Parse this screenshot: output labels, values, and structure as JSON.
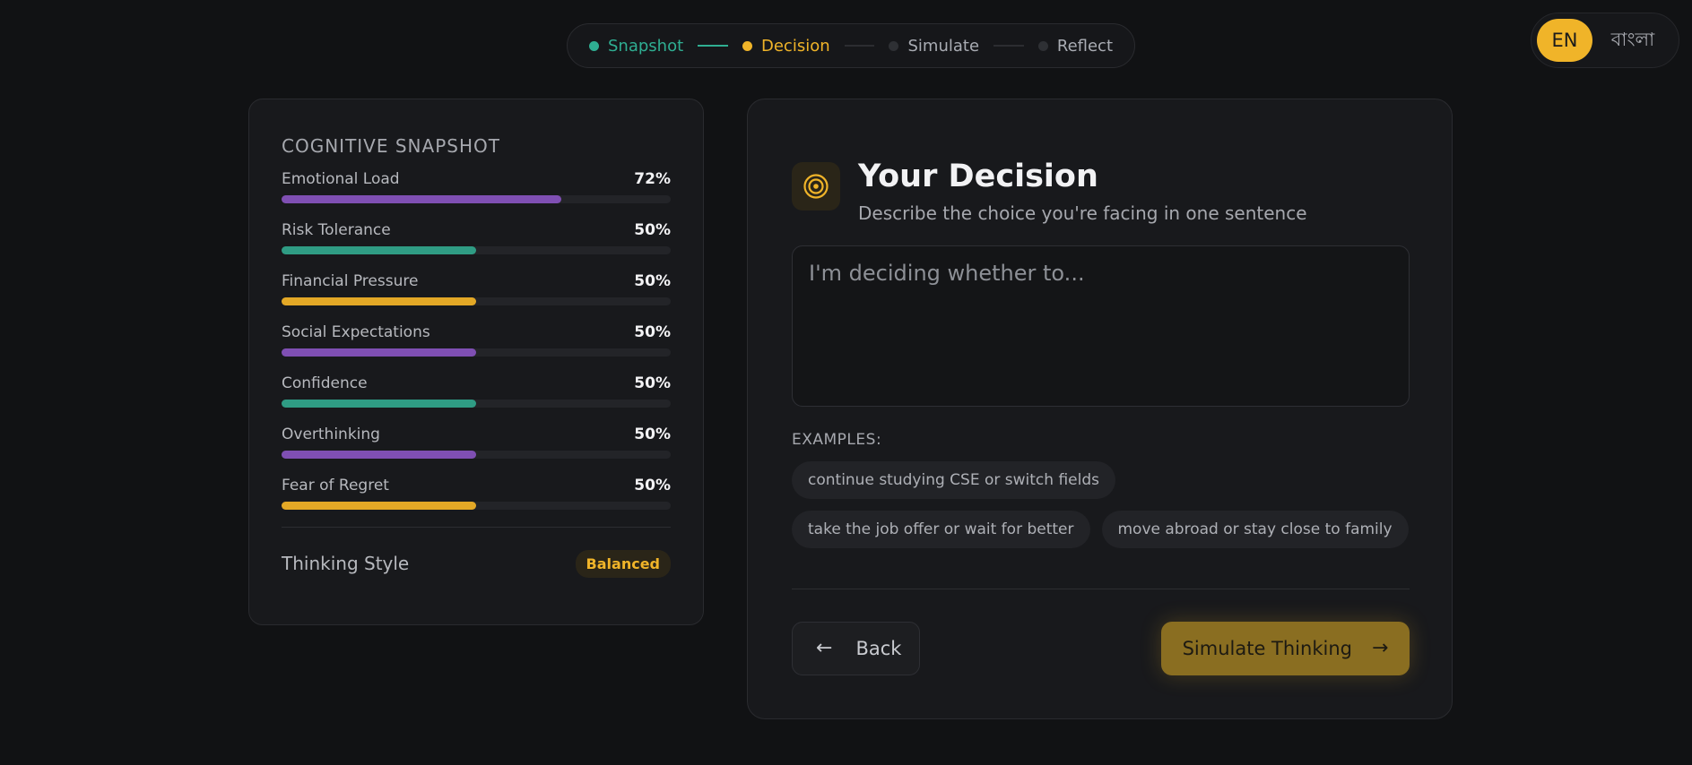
{
  "stepper": {
    "steps": [
      {
        "label": "Snapshot",
        "state": "done"
      },
      {
        "label": "Decision",
        "state": "active"
      },
      {
        "label": "Simulate",
        "state": "idle"
      },
      {
        "label": "Reflect",
        "state": "idle"
      }
    ]
  },
  "language": {
    "en": "EN",
    "bn": "বাংলা",
    "selected": "EN"
  },
  "snapshot": {
    "title": "COGNITIVE SNAPSHOT",
    "metrics": [
      {
        "label": "Emotional Load",
        "value": "72%",
        "percent": 72,
        "color": "#7f4fb3"
      },
      {
        "label": "Risk Tolerance",
        "value": "50%",
        "percent": 50,
        "color": "#2f9c84"
      },
      {
        "label": "Financial Pressure",
        "value": "50%",
        "percent": 50,
        "color": "#e3a826"
      },
      {
        "label": "Social Expectations",
        "value": "50%",
        "percent": 50,
        "color": "#7f4fb3"
      },
      {
        "label": "Confidence",
        "value": "50%",
        "percent": 50,
        "color": "#2f9c84"
      },
      {
        "label": "Overthinking",
        "value": "50%",
        "percent": 50,
        "color": "#7f4fb3"
      },
      {
        "label": "Fear of Regret",
        "value": "50%",
        "percent": 50,
        "color": "#e3a826"
      }
    ],
    "thinking_style_label": "Thinking Style",
    "thinking_style_value": "Balanced"
  },
  "decision": {
    "title": "Your Decision",
    "subtitle": "Describe the choice you're facing in one sentence",
    "input_value": "",
    "input_placeholder": "I'm deciding whether to...",
    "examples_label": "EXAMPLES:",
    "examples": [
      "continue studying CSE or switch fields",
      "take the job offer or wait for better",
      "move abroad or stay close to family"
    ],
    "back_label": "Back",
    "simulate_label": "Simulate Thinking"
  },
  "colors": {
    "accent": "#f0b429",
    "teal": "#2fae92",
    "purple": "#7f4fb3",
    "background": "#111214"
  }
}
